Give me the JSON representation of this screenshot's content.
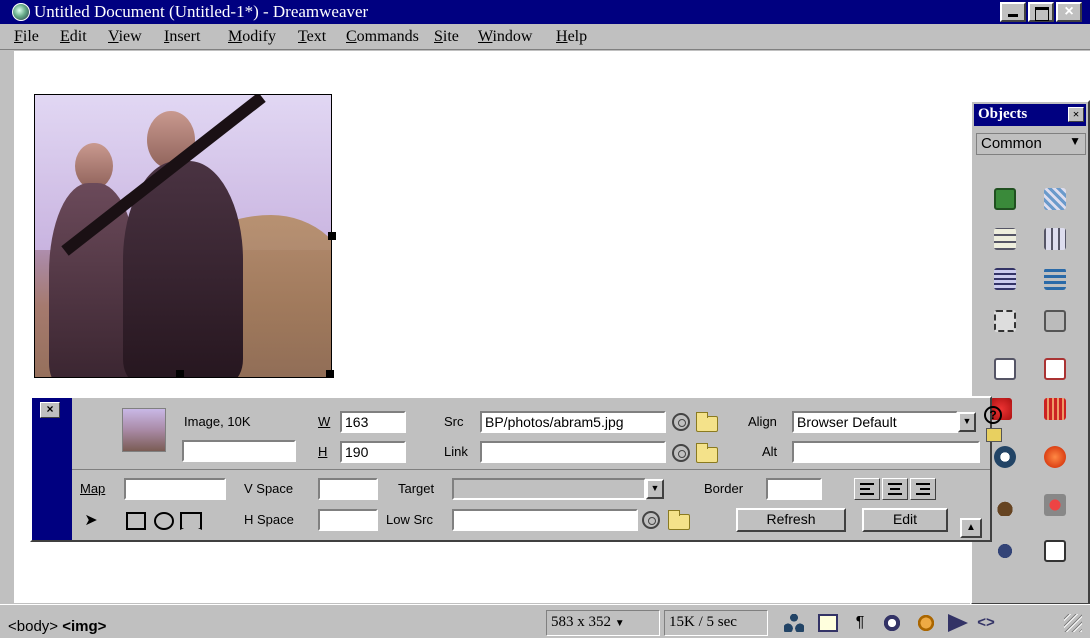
{
  "window": {
    "title": "Untitled Document (Untitled-1*) - Dreamweaver",
    "close_glyph": "×"
  },
  "menu": [
    "File",
    "Edit",
    "View",
    "Insert",
    "Modify",
    "Text",
    "Commands",
    "Site",
    "Window",
    "Help"
  ],
  "objects_panel": {
    "title": "Objects",
    "category": "Common",
    "close_glyph": "×",
    "icons": [
      "image-icon",
      "rollover-image-icon",
      "table-icon",
      "tabular-data-icon",
      "horizontal-rule-icon",
      "navigation-bar-icon",
      "layer-icon",
      "line-break-icon",
      "email-link-icon",
      "date-icon",
      "flash-icon",
      "fireworks-icon",
      "shockwave-icon",
      "generator-icon",
      "applet-icon",
      "activex-icon",
      "plugin-icon",
      "server-side-include-icon"
    ]
  },
  "property_inspector": {
    "close_glyph": "×",
    "image_label": "Image, 10K",
    "image_name_value": "",
    "w_label": "W",
    "w_value": "163",
    "h_label": "H",
    "h_value": "190",
    "src_label": "Src",
    "src_value": "BP/photos/abram5.jpg",
    "link_label": "Link",
    "link_value": "",
    "align_label": "Align",
    "align_value": "Browser Default",
    "alt_label": "Alt",
    "alt_value": "",
    "map_label": "Map",
    "map_value": "",
    "vspace_label": "V Space",
    "vspace_value": "",
    "hspace_label": "H Space",
    "hspace_value": "",
    "target_label": "Target",
    "target_value": "",
    "lowsrc_label": "Low Src",
    "lowsrc_value": "",
    "border_label": "Border",
    "border_value": "",
    "refresh_label": "Refresh",
    "edit_label": "Edit"
  },
  "status_bar": {
    "tag_body": "<body>",
    "tag_img": "<img>",
    "window_size": "583 x 352",
    "download": "15K / 5 sec"
  },
  "colors": {
    "titlebar": "#000080",
    "chrome": "#c0c0c0"
  }
}
